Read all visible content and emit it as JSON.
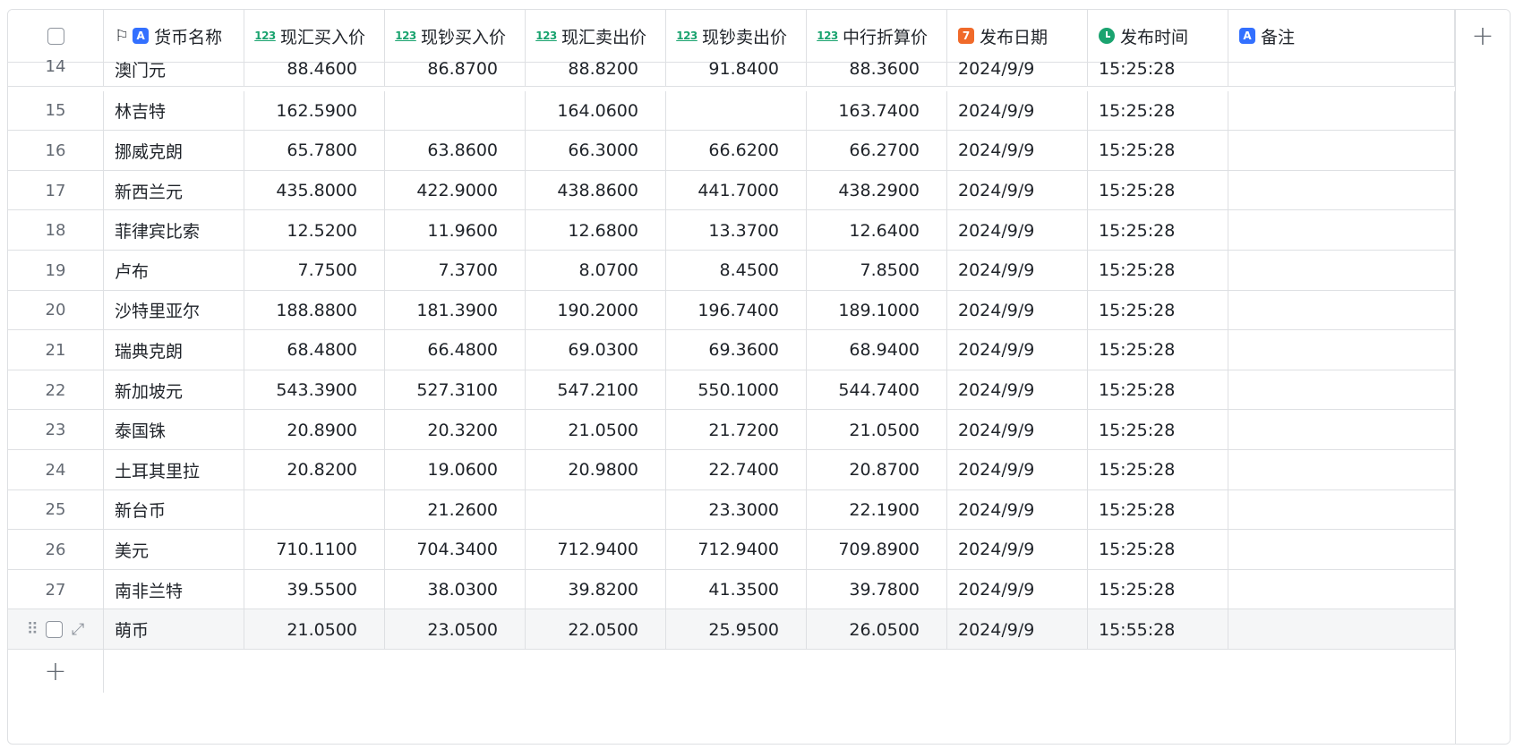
{
  "columns": [
    {
      "label": "货币名称",
      "type": "text"
    },
    {
      "label": "现汇买入价",
      "type": "number"
    },
    {
      "label": "现钞买入价",
      "type": "number"
    },
    {
      "label": "现汇卖出价",
      "type": "number"
    },
    {
      "label": "现钞卖出价",
      "type": "number"
    },
    {
      "label": "中行折算价",
      "type": "number"
    },
    {
      "label": "发布日期",
      "type": "date"
    },
    {
      "label": "发布时间",
      "type": "time"
    },
    {
      "label": "备注",
      "type": "text"
    }
  ],
  "type_icons": {
    "number": "123",
    "text": "A",
    "date": "7"
  },
  "rows": [
    {
      "index": "14",
      "cells": [
        "澳门元",
        "88.4600",
        "86.8700",
        "88.8200",
        "91.8400",
        "88.3600",
        "2024/9/9",
        "15:25:28",
        ""
      ]
    },
    {
      "index": "15",
      "cells": [
        "林吉特",
        "162.5900",
        "",
        "164.0600",
        "",
        "163.7400",
        "2024/9/9",
        "15:25:28",
        ""
      ]
    },
    {
      "index": "16",
      "cells": [
        "挪威克朗",
        "65.7800",
        "63.8600",
        "66.3000",
        "66.6200",
        "66.2700",
        "2024/9/9",
        "15:25:28",
        ""
      ]
    },
    {
      "index": "17",
      "cells": [
        "新西兰元",
        "435.8000",
        "422.9000",
        "438.8600",
        "441.7000",
        "438.2900",
        "2024/9/9",
        "15:25:28",
        ""
      ]
    },
    {
      "index": "18",
      "cells": [
        "菲律宾比索",
        "12.5200",
        "11.9600",
        "12.6800",
        "13.3700",
        "12.6400",
        "2024/9/9",
        "15:25:28",
        ""
      ]
    },
    {
      "index": "19",
      "cells": [
        "卢布",
        "7.7500",
        "7.3700",
        "8.0700",
        "8.4500",
        "7.8500",
        "2024/9/9",
        "15:25:28",
        ""
      ]
    },
    {
      "index": "20",
      "cells": [
        "沙特里亚尔",
        "188.8800",
        "181.3900",
        "190.2000",
        "196.7400",
        "189.1000",
        "2024/9/9",
        "15:25:28",
        ""
      ]
    },
    {
      "index": "21",
      "cells": [
        "瑞典克朗",
        "68.4800",
        "66.4800",
        "69.0300",
        "69.3600",
        "68.9400",
        "2024/9/9",
        "15:25:28",
        ""
      ]
    },
    {
      "index": "22",
      "cells": [
        "新加坡元",
        "543.3900",
        "527.3100",
        "547.2100",
        "550.1000",
        "544.7400",
        "2024/9/9",
        "15:25:28",
        ""
      ]
    },
    {
      "index": "23",
      "cells": [
        "泰国铢",
        "20.8900",
        "20.3200",
        "21.0500",
        "21.7200",
        "21.0500",
        "2024/9/9",
        "15:25:28",
        ""
      ]
    },
    {
      "index": "24",
      "cells": [
        "土耳其里拉",
        "20.8200",
        "19.0600",
        "20.9800",
        "22.7400",
        "20.8700",
        "2024/9/9",
        "15:25:28",
        ""
      ]
    },
    {
      "index": "25",
      "cells": [
        "新台币",
        "",
        "21.2600",
        "",
        "23.3000",
        "22.1900",
        "2024/9/9",
        "15:25:28",
        ""
      ]
    },
    {
      "index": "26",
      "cells": [
        "美元",
        "710.1100",
        "704.3400",
        "712.9400",
        "712.9400",
        "709.8900",
        "2024/9/9",
        "15:25:28",
        ""
      ]
    },
    {
      "index": "27",
      "cells": [
        "南非兰特",
        "39.5500",
        "38.0300",
        "39.8200",
        "41.3500",
        "39.7800",
        "2024/9/9",
        "15:25:28",
        ""
      ]
    },
    {
      "index": "",
      "hovered": true,
      "cells": [
        "萌币",
        "21.0500",
        "23.0500",
        "22.0500",
        "25.9500",
        "26.0500",
        "2024/9/9",
        "15:55:28",
        ""
      ]
    }
  ],
  "icons": {
    "select_all": "checkbox-icon",
    "add_column": "plus-icon",
    "add_row": "plus-icon",
    "primary_field": "flag-icon",
    "drag": "drag-handle-icon",
    "expand": "expand-icon"
  }
}
